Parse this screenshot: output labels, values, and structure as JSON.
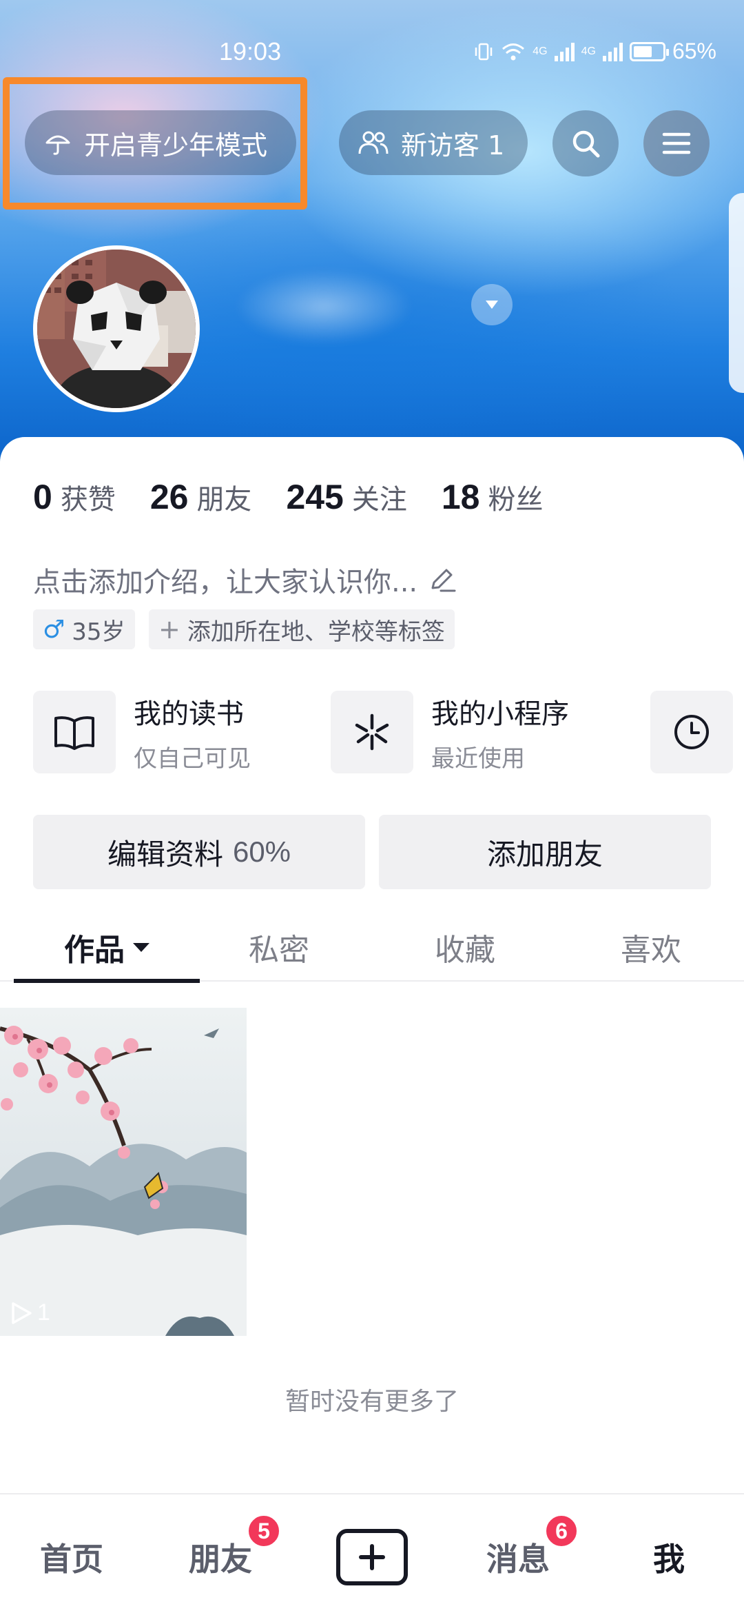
{
  "status_bar": {
    "time": "19:03",
    "network_1": "4G",
    "network_2": "4G",
    "battery_percent": "65%",
    "battery_level": 0.65
  },
  "header": {
    "teen_mode_label": "开启青少年模式",
    "visitors_label": "新访客 1",
    "search_icon": "search-icon",
    "menu_icon": "menu-icon",
    "highlight_color": "#f7892b"
  },
  "profile": {
    "stats": [
      {
        "num": "0",
        "label": "获赞"
      },
      {
        "num": "26",
        "label": "朋友"
      },
      {
        "num": "245",
        "label": "关注"
      },
      {
        "num": "18",
        "label": "粉丝"
      }
    ],
    "intro_placeholder": "点击添加介绍，让大家认识你...",
    "gender_symbol": "♂",
    "age": "35岁",
    "add_tags_label": "添加所在地、学校等标签"
  },
  "shortcuts": [
    {
      "title": "我的读书",
      "subtitle": "仅自己可见",
      "icon": "book-icon"
    },
    {
      "title": "我的小程序",
      "subtitle": "最近使用",
      "icon": "mini-program-icon"
    },
    {
      "icon": "clock-icon"
    }
  ],
  "actions": {
    "edit_profile": "编辑资料",
    "edit_progress": "60%",
    "add_friends": "添加朋友"
  },
  "tabs": [
    {
      "label": "作品",
      "active": true
    },
    {
      "label": "私密",
      "active": false
    },
    {
      "label": "收藏",
      "active": false
    },
    {
      "label": "喜欢",
      "active": false
    }
  ],
  "videos": [
    {
      "play_count": "1"
    }
  ],
  "footer_text": "暂时没有更多了",
  "bottom_nav": {
    "home": "首页",
    "friends": "朋友",
    "friends_badge": "5",
    "messages": "消息",
    "messages_badge": "6",
    "me": "我"
  },
  "colors": {
    "badge": "#f2385a",
    "text_primary": "#161823",
    "male_blue": "#2b8fe3"
  }
}
